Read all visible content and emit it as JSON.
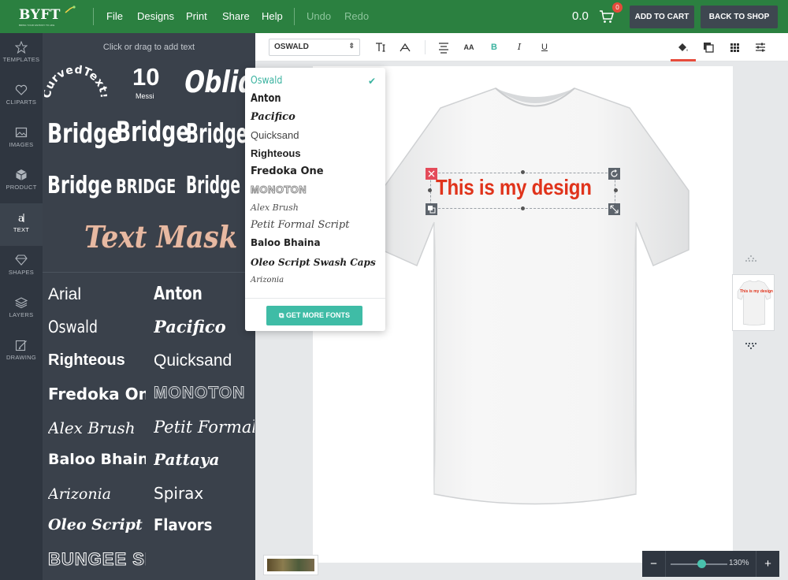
{
  "topbar": {
    "logo": "BYFT",
    "logo_tagline": "BRING YOUR FANTASY TO LIFE",
    "menu": [
      "File",
      "Designs",
      "Print",
      "Share",
      "Help"
    ],
    "undo": "Undo",
    "redo": "Redo",
    "price": "0.0",
    "cart_count": "0",
    "add_to_cart": "ADD TO CART",
    "back_to_shop": "BACK TO SHOP",
    "colors": {
      "bar": "#2b8040",
      "button": "#3e4750",
      "badge": "#e44b3a"
    }
  },
  "nav": {
    "items": [
      {
        "label": "TEMPLATES",
        "icon": "star-icon"
      },
      {
        "label": "CLIPARTS",
        "icon": "heart-icon"
      },
      {
        "label": "IMAGES",
        "icon": "image-icon"
      },
      {
        "label": "PRODUCT",
        "icon": "box-icon"
      },
      {
        "label": "TEXT",
        "icon": "text-icon",
        "active": true
      },
      {
        "label": "SHAPES",
        "icon": "diamond-icon"
      },
      {
        "label": "LAYERS",
        "icon": "layers-icon"
      },
      {
        "label": "DRAWING",
        "icon": "pencil-icon"
      }
    ]
  },
  "panel": {
    "hint": "Click or drag to add text",
    "presets": {
      "curved": "CurvedText!",
      "jersey_number": "10",
      "jersey_name": "Messi",
      "oblique": "Oblique",
      "bridge_1": "Bridge",
      "bridge_2": "Bridge",
      "bridge_3": "Bridge",
      "bridge_4": "Bridge",
      "bridge_5": "BRIDGE",
      "bridge_6": "Bridge",
      "text_mask": "Text Mask"
    },
    "fonts_left": [
      "Arial",
      "Oswald",
      "Righteous",
      "Fredoka One",
      "Alex Brush",
      "Baloo Bhaina",
      "Arizonia",
      "Oleo Script Swash Caps",
      "BUNGEE SHADE"
    ],
    "fonts_right": [
      "Anton",
      "Pacifico",
      "Quicksand",
      "MONOTON",
      "Petit Formal Script",
      "Pattaya",
      "Spirax",
      "Flavors"
    ]
  },
  "toolbar": {
    "font_select_value": "OSWALD",
    "buttons": [
      "text-size-icon",
      "text-curve-icon",
      "align-center-icon",
      "font-case-icon",
      "bold-icon",
      "italic-icon",
      "underline-icon",
      "fill-color-icon",
      "stroke-icon",
      "pattern-icon",
      "settings-sliders-icon"
    ],
    "bold_label": "B",
    "italic_label": "I",
    "underline_label": "U",
    "case_label": "AA"
  },
  "dropdown": {
    "items": [
      "Oswald",
      "Anton",
      "Pacifico",
      "Quicksand",
      "Righteous",
      "Fredoka One",
      "MONOTON",
      "Alex Brush",
      "Petit Formal Script",
      "Baloo Bhaina",
      "Oleo Script Swash Caps",
      "Arizonia"
    ],
    "selected": "Oswald",
    "get_more_fonts": "GET MORE FONTS",
    "accent_color": "#3fbca6"
  },
  "canvas": {
    "design_text": "This is my design",
    "design_text_color": "#e0331b",
    "thumb_text": "This is my design"
  },
  "zoom": {
    "minus": "−",
    "plus": "+",
    "value": "130%",
    "level": 0.55
  }
}
